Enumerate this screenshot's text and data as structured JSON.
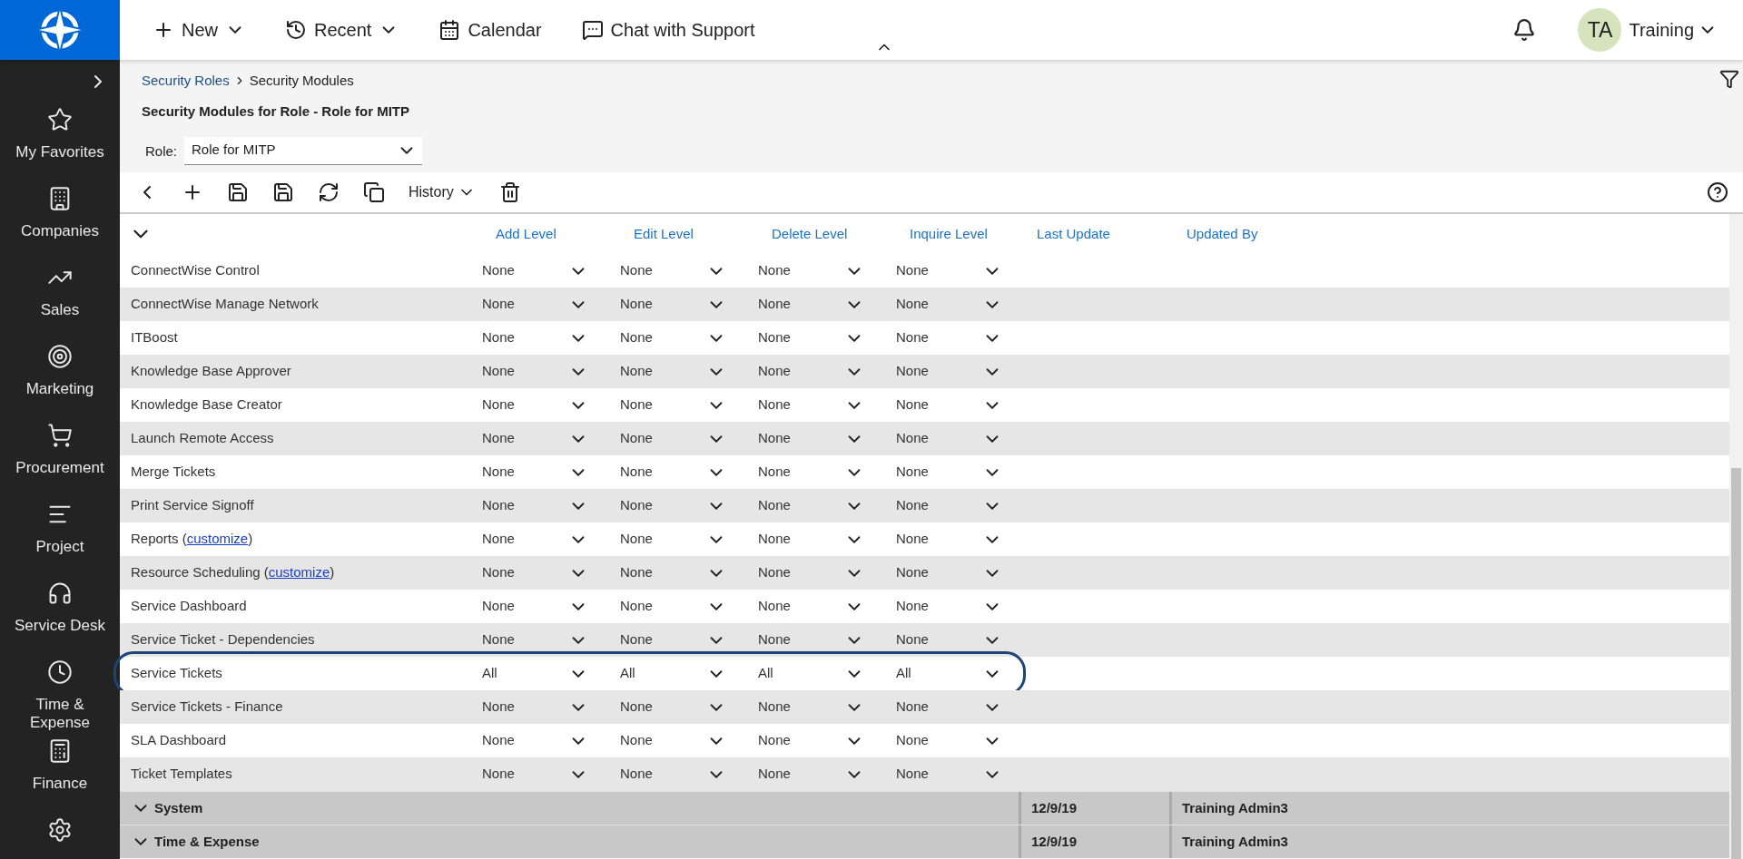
{
  "topbar": {
    "nav": [
      {
        "label": "New",
        "caret": true
      },
      {
        "label": "Recent",
        "caret": true
      },
      {
        "label": "Calendar",
        "caret": false
      },
      {
        "label": "Chat with Support",
        "caret": false
      }
    ],
    "user": {
      "initials": "TA",
      "name": "Training"
    }
  },
  "sidebar": {
    "items": [
      {
        "label": "My Favorites"
      },
      {
        "label": "Companies"
      },
      {
        "label": "Sales"
      },
      {
        "label": "Marketing"
      },
      {
        "label": "Procurement"
      },
      {
        "label": "Project"
      },
      {
        "label": "Service Desk"
      },
      {
        "label": "Time & Expense"
      },
      {
        "label": "Finance"
      }
    ]
  },
  "breadcrumb": [
    "Security Roles",
    "Security Modules"
  ],
  "page_title": "Security Modules for Role - Role for MITP",
  "role": {
    "label": "Role:",
    "value": "Role for MITP"
  },
  "toolbar": {
    "history": "History"
  },
  "table": {
    "columns": [
      "Add Level",
      "Edit Level",
      "Delete Level",
      "Inquire Level",
      "Last Update",
      "Updated By"
    ],
    "rows": [
      {
        "name": "ConnectWise Control",
        "levels": [
          "None",
          "None",
          "None",
          "None"
        ],
        "circled": false
      },
      {
        "name": "ConnectWise Manage Network",
        "levels": [
          "None",
          "None",
          "None",
          "None"
        ],
        "circled": false
      },
      {
        "name": "ITBoost",
        "levels": [
          "None",
          "None",
          "None",
          "None"
        ],
        "circled": false
      },
      {
        "name": "Knowledge Base Approver",
        "levels": [
          "None",
          "None",
          "None",
          "None"
        ],
        "circled": false
      },
      {
        "name": "Knowledge Base Creator",
        "levels": [
          "None",
          "None",
          "None",
          "None"
        ],
        "circled": false
      },
      {
        "name": "Launch Remote Access",
        "levels": [
          "None",
          "None",
          "None",
          "None"
        ],
        "circled": false
      },
      {
        "name": "Merge Tickets",
        "levels": [
          "None",
          "None",
          "None",
          "None"
        ],
        "circled": false
      },
      {
        "name": "Print Service Signoff",
        "levels": [
          "None",
          "None",
          "None",
          "None"
        ],
        "circled": false
      },
      {
        "name": "Reports (",
        "link": "customize",
        "suffix": ")",
        "levels": [
          "None",
          "None",
          "None",
          "None"
        ],
        "circled": false
      },
      {
        "name": "Resource Scheduling (",
        "link": "customize",
        "suffix": ")",
        "levels": [
          "None",
          "None",
          "None",
          "None"
        ],
        "circled": false
      },
      {
        "name": "Service Dashboard",
        "levels": [
          "None",
          "None",
          "None",
          "None"
        ],
        "circled": false
      },
      {
        "name": "Service Ticket - Dependencies",
        "levels": [
          "None",
          "None",
          "None",
          "None"
        ],
        "circled": false
      },
      {
        "name": "Service Tickets",
        "levels": [
          "All",
          "All",
          "All",
          "All"
        ],
        "circled": true
      },
      {
        "name": "Service Tickets - Finance",
        "levels": [
          "None",
          "None",
          "None",
          "None"
        ],
        "circled": false
      },
      {
        "name": "SLA Dashboard",
        "levels": [
          "None",
          "None",
          "None",
          "None"
        ],
        "circled": false
      },
      {
        "name": "Ticket Templates",
        "levels": [
          "None",
          "None",
          "None",
          "None"
        ],
        "circled": false
      }
    ],
    "groups": [
      {
        "label": "System",
        "last_update": "12/9/19",
        "updated_by": "Training Admin3"
      },
      {
        "label": "Time & Expense",
        "last_update": "12/9/19",
        "updated_by": "Training Admin3"
      }
    ]
  }
}
